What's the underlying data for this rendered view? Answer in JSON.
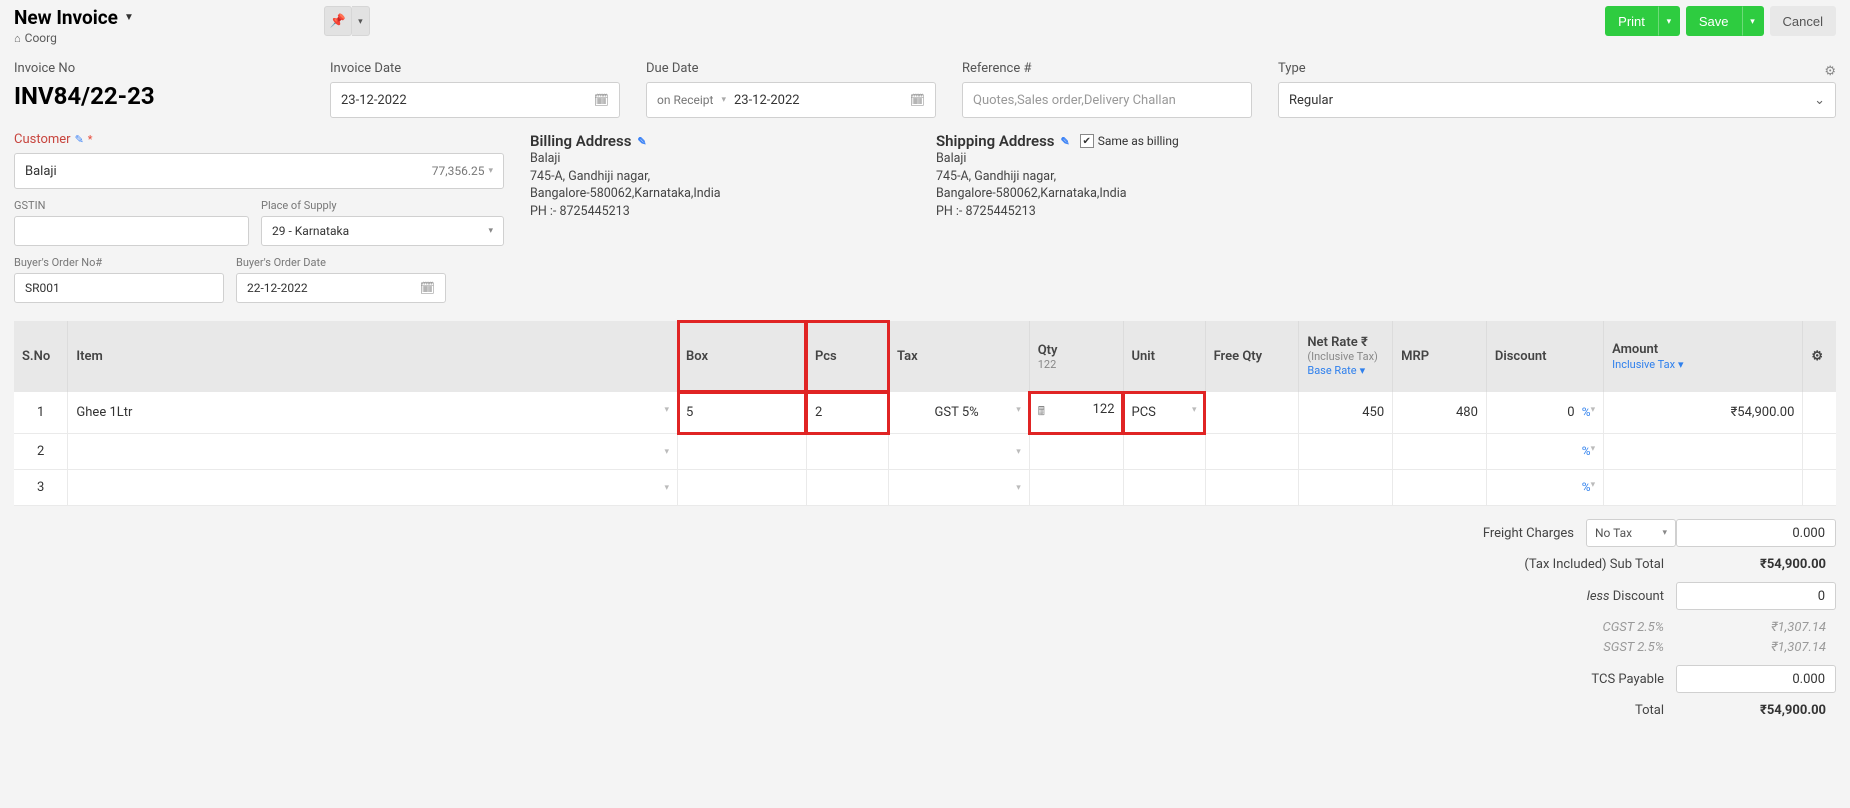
{
  "header": {
    "title": "New Invoice",
    "location": "Coorg",
    "print": "Print",
    "save": "Save",
    "cancel": "Cancel"
  },
  "form": {
    "invoice_no_label": "Invoice No",
    "invoice_no": "INV84/22-23",
    "invoice_date_label": "Invoice Date",
    "invoice_date": "23-12-2022",
    "due_date_label": "Due Date",
    "due_date_mode": "on Receipt",
    "due_date": "23-12-2022",
    "reference_label": "Reference #",
    "reference_placeholder": "Quotes,Sales order,Delivery Challan",
    "type_label": "Type",
    "type_value": "Regular",
    "customer_label": "Customer",
    "customer_value": "Balaji",
    "customer_balance": "77,356.25",
    "gstin_label": "GSTIN",
    "gstin_value": "",
    "pos_label": "Place of Supply",
    "pos_value": "29 - Karnataka",
    "buyer_order_no_label": "Buyer's Order No#",
    "buyer_order_no": "SR001",
    "buyer_order_date_label": "Buyer's Order Date",
    "buyer_order_date": "22-12-2022",
    "billing_title": "Billing Address",
    "billing_name": "Balaji",
    "billing_line1": "745-A, Gandhiji nagar,",
    "billing_line2": "Bangalore-580062,Karnataka,India",
    "billing_phone": "PH :- 8725445213",
    "shipping_title": "Shipping Address",
    "same_as_billing_label": "Same as billing",
    "shipping_name": "Balaji",
    "shipping_line1": "745-A, Gandhiji nagar,",
    "shipping_line2": "Bangalore-580062,Karnataka,India",
    "shipping_phone": "PH :- 8725445213"
  },
  "table": {
    "headers": {
      "sno": "S.No",
      "item": "Item",
      "box": "Box",
      "pcs": "Pcs",
      "tax": "Tax",
      "qty": "Qty",
      "qty_sub": "122",
      "unit": "Unit",
      "free_qty": "Free Qty",
      "net_rate": "Net Rate ₹",
      "net_rate_sub1": "(Inclusive Tax)",
      "net_rate_sub2": "Base Rate",
      "mrp": "MRP",
      "discount": "Discount",
      "amount": "Amount",
      "amount_sub": "Inclusive Tax"
    },
    "rows": [
      {
        "sno": "1",
        "item": "Ghee 1Ltr",
        "box": "5",
        "pcs": "2",
        "tax": "GST 5%",
        "qty": "122",
        "unit": "PCS",
        "freeqty": "",
        "netrate": "450",
        "mrp": "480",
        "discount": "0",
        "disc_unit": "%",
        "amount": "₹54,900.00"
      },
      {
        "sno": "2",
        "item": "",
        "box": "",
        "pcs": "",
        "tax": "",
        "qty": "",
        "unit": "",
        "freeqty": "",
        "netrate": "",
        "mrp": "",
        "discount": "",
        "disc_unit": "%",
        "amount": ""
      },
      {
        "sno": "3",
        "item": "",
        "box": "",
        "pcs": "",
        "tax": "",
        "qty": "",
        "unit": "",
        "freeqty": "",
        "netrate": "",
        "mrp": "",
        "discount": "",
        "disc_unit": "%",
        "amount": ""
      }
    ]
  },
  "totals": {
    "freight_label": "Freight Charges",
    "freight_tax": "No Tax",
    "freight_val": "0.000",
    "subtotal_label": "(Tax Included) Sub Total",
    "subtotal_val": "₹54,900.00",
    "discount_label_pre": "less ",
    "discount_label": "Discount",
    "discount_val": "0",
    "cgst_label": "CGST 2.5%",
    "cgst_val": "₹1,307.14",
    "sgst_label": "SGST 2.5%",
    "sgst_val": "₹1,307.14",
    "tcs_label": "TCS Payable",
    "tcs_val": "0.000",
    "total_label": "Total",
    "total_val": "₹54,900.00"
  }
}
